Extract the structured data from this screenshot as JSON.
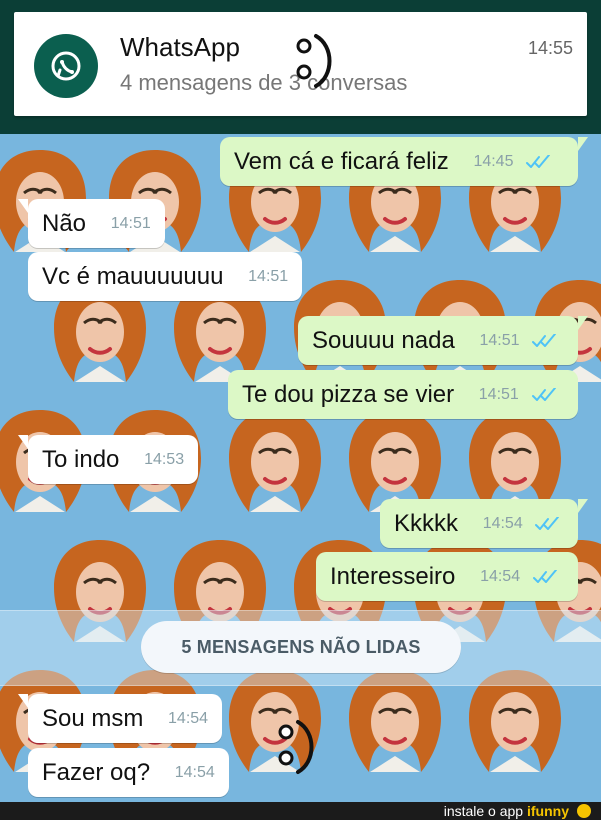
{
  "notification": {
    "app_name": "WhatsApp",
    "subtitle": "4 mensagens de 3 conversas",
    "time": "14:55",
    "icon": "whatsapp-icon"
  },
  "messages": [
    {
      "dir": "out",
      "text": "Vem cá e ficará feliz",
      "time": "14:45",
      "ticks": "double-check-icon"
    },
    {
      "dir": "in",
      "text": "Não",
      "time": "14:51"
    },
    {
      "dir": "in",
      "text": "Vc é mauuuuuuu",
      "time": "14:51"
    },
    {
      "dir": "out",
      "text": "Souuuu nada",
      "time": "14:51",
      "ticks": "double-check-icon"
    },
    {
      "dir": "out",
      "text": "Te dou pizza se vier",
      "time": "14:51",
      "ticks": "double-check-icon"
    },
    {
      "dir": "in",
      "text": "To indo",
      "time": "14:53"
    },
    {
      "dir": "out",
      "text": "Kkkkk",
      "time": "14:54",
      "ticks": "double-check-icon"
    },
    {
      "dir": "out",
      "text": "Interesseiro",
      "time": "14:54",
      "ticks": "double-check-icon"
    },
    {
      "dir": "in",
      "text": "Sou msm",
      "time": "14:54"
    },
    {
      "dir": "in",
      "text": "Fazer oq?",
      "time": "14:54"
    }
  ],
  "unread": {
    "label": "5 MENSAGENS NÃO LIDAS"
  },
  "footer": {
    "prefix": "instale o app",
    "brand": "ifunny"
  },
  "colors": {
    "wallpaper": "#78b6de",
    "incoming_bubble": "#ffffff",
    "outgoing_bubble": "#dcf8c6",
    "notification_bg": "#ffffff",
    "header_dark": "#0b3e36",
    "tick_blue": "#4fc3f7"
  }
}
